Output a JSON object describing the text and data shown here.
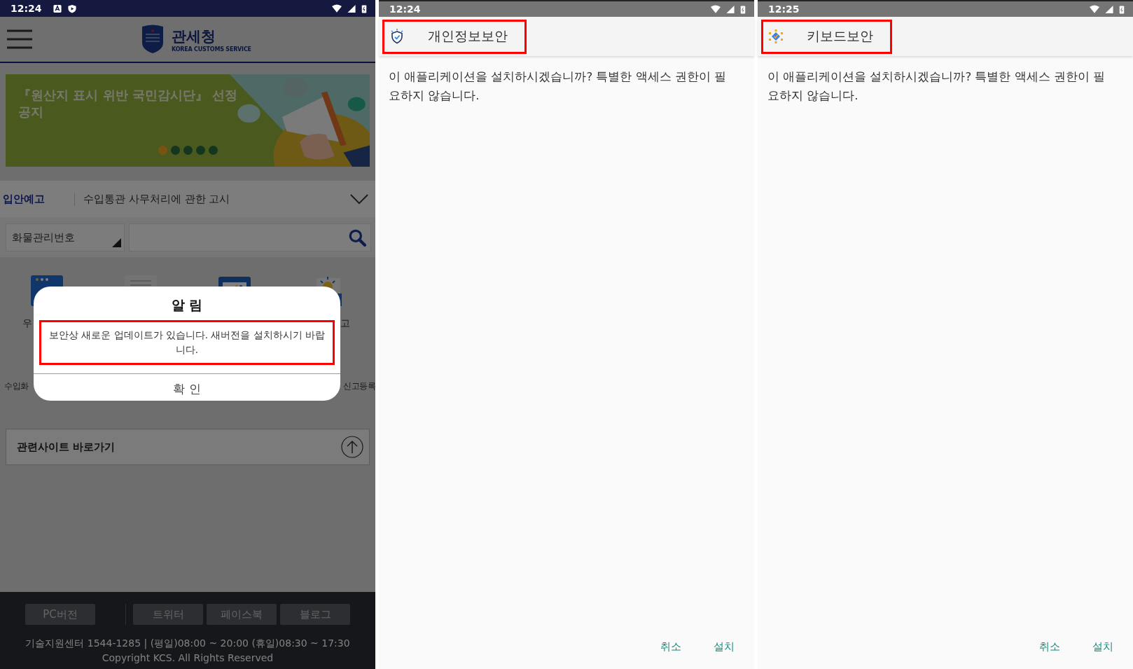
{
  "customs_app": {
    "status_bar": {
      "time": "12:24"
    },
    "header": {
      "title": "관세청",
      "subtitle": "KOREA CUSTOMS SERVICE"
    },
    "banner": {
      "text": "『원산지 표시 위반 국민감시단』 선정 공지",
      "dots": [
        {
          "selected": true
        },
        {
          "selected": false
        },
        {
          "selected": false
        },
        {
          "selected": false
        },
        {
          "selected": false
        }
      ]
    },
    "notice": {
      "label": "입안예고",
      "text": "수입통관 사무처리에 관한 고시"
    },
    "search": {
      "category": "화물관리번호"
    },
    "menu_rows": [
      {
        "items": [
          "우",
          "고"
        ]
      },
      {
        "items": [
          "수입화",
          "신고등록"
        ]
      }
    ],
    "related_sites": {
      "label": "관련사이트 바로가기"
    },
    "footer": {
      "links": [
        "PC버전",
        "트위터",
        "페이스북",
        "블로그"
      ],
      "info": "기술지원센터 1544-1285 | (평일)08:00 ~ 20:00 (휴일)08:30 ~ 17:30",
      "copyright": "Copyright KCS. All Rights Reserved"
    },
    "dialog": {
      "title": "알 림",
      "message": "보안상 새로운 업데이트가 있습니다. 새버전을 설치하시기 바랍니다.",
      "button": "확 인",
      "highlighted": true
    }
  },
  "installers": [
    {
      "time": "12:24",
      "kind": "shield",
      "app_name": "개인정보보안",
      "highlighted": true,
      "message": "이 애플리케이션을 설치하시겠습니까? 특별한 액세스 권한이 필요하지 않습니다.",
      "buttons": [
        "취소",
        "설치"
      ]
    },
    {
      "time": "12:25",
      "kind": "network",
      "app_name": "키보드보안",
      "highlighted": true,
      "message": "이 애플리케이션을 설치하시겠습니까? 특별한 액세스 권한이 필요하지 않습니다.",
      "buttons": [
        "취소",
        "설치"
      ]
    }
  ]
}
